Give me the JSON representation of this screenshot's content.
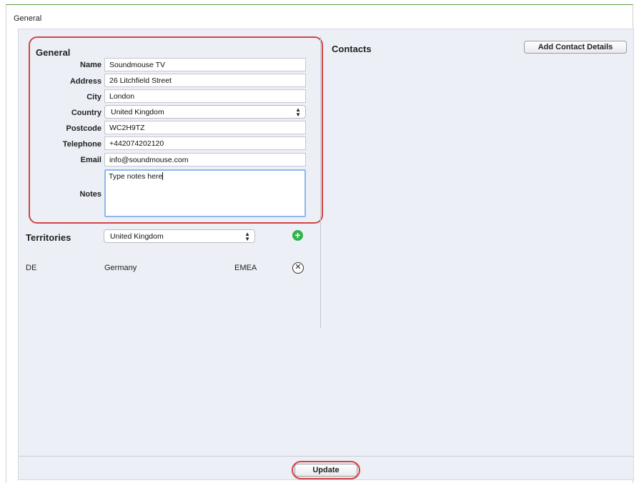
{
  "tab": {
    "title": "General"
  },
  "general": {
    "title": "General",
    "fields": {
      "name": {
        "label": "Name",
        "value": "Soundmouse TV"
      },
      "address": {
        "label": "Address",
        "value": "26 Litchfield Street"
      },
      "city": {
        "label": "City",
        "value": "London"
      },
      "country": {
        "label": "Country",
        "value": "United Kingdom"
      },
      "postcode": {
        "label": "Postcode",
        "value": "WC2H9TZ"
      },
      "telephone": {
        "label": "Telephone",
        "value": "+442074202120"
      },
      "email": {
        "label": "Email",
        "value": "info@soundmouse.com"
      },
      "notes": {
        "label": "Notes",
        "value": "Type notes here"
      }
    }
  },
  "territories": {
    "title": "Territories",
    "select_value": "United Kingdom",
    "rows": [
      {
        "code": "DE",
        "name": "Germany",
        "region": "EMEA"
      }
    ]
  },
  "contacts": {
    "title": "Contacts",
    "add_label": "Add Contact Details"
  },
  "footer": {
    "update_label": "Update"
  },
  "icons": {
    "add": "plus-circle-icon",
    "remove": "remove-circle-icon",
    "select_arrows": "updown-arrows-icon"
  },
  "colors": {
    "panel_bg": "#eceff5",
    "highlight": "#d24444",
    "add_green": "#2fb44a",
    "focus_blue": "#8db8ec"
  }
}
